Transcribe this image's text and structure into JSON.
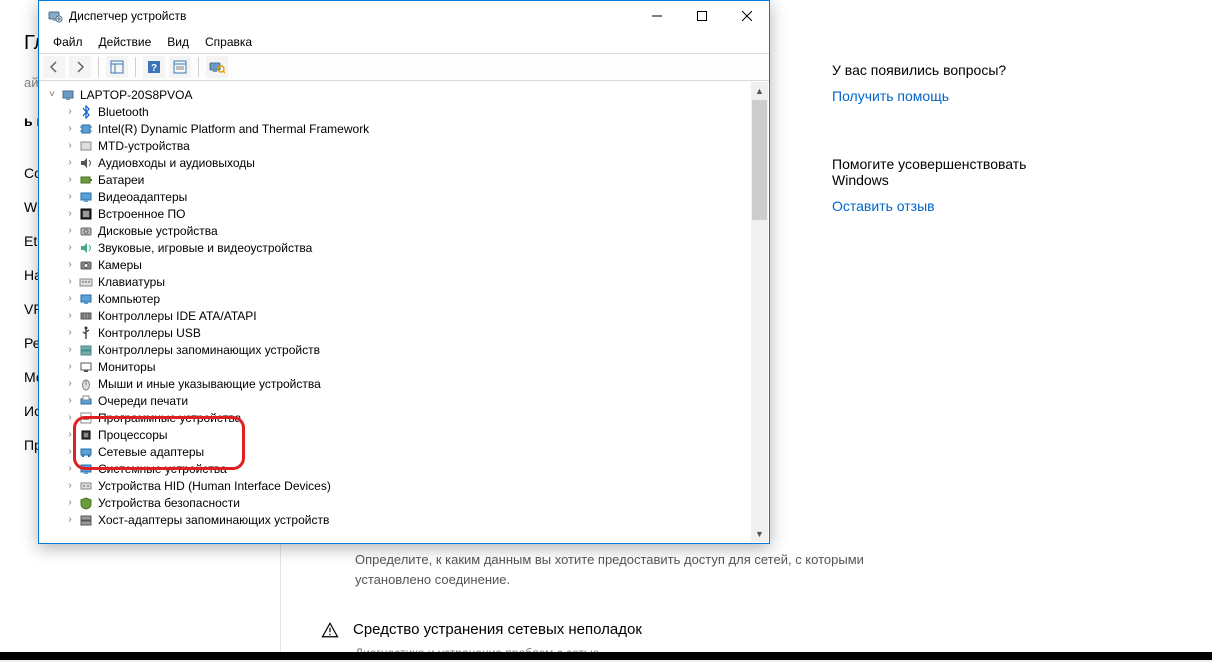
{
  "background": {
    "leftPanel": {
      "header": "Глав",
      "search": "айти ...",
      "sectionPrefix": "ь и И",
      "items": [
        "Сост",
        "Wi-F",
        "Ether",
        "Набо",
        "VPN",
        "Режи",
        "Моб",
        "Исп",
        "Про"
      ]
    },
    "aside": {
      "question": "У вас появились вопросы?",
      "helpLink": "Получить помощь",
      "improve": "Помогите усовершенствовать Windows",
      "feedbackLink": "Оставить отзыв"
    },
    "firewall": {
      "desc": "Определите, к каким данным вы хотите предоставить доступ для сетей, с которыми установлено соединение."
    },
    "troubleshoot": {
      "title": "Средство устранения сетевых неполадок",
      "sub": "Диагностика и устранение проблем с сетью."
    }
  },
  "dm": {
    "title": "Диспетчер устройств",
    "menus": [
      "Файл",
      "Действие",
      "Вид",
      "Справка"
    ],
    "root": "LAPTOP-20S8PVOA",
    "items": [
      {
        "icon": "bluetooth",
        "label": "Bluetooth"
      },
      {
        "icon": "chip",
        "label": "Intel(R) Dynamic Platform and Thermal Framework"
      },
      {
        "icon": "mtd",
        "label": "MTD-устройства"
      },
      {
        "icon": "audio",
        "label": "Аудиовходы и аудиовыходы"
      },
      {
        "icon": "battery",
        "label": "Батареи"
      },
      {
        "icon": "video",
        "label": "Видеоадаптеры"
      },
      {
        "icon": "firmware",
        "label": "Встроенное ПО"
      },
      {
        "icon": "disk",
        "label": "Дисковые устройства"
      },
      {
        "icon": "sound",
        "label": "Звуковые, игровые и видеоустройства"
      },
      {
        "icon": "camera",
        "label": "Камеры"
      },
      {
        "icon": "keyboard",
        "label": "Клавиатуры"
      },
      {
        "icon": "computer",
        "label": "Компьютер"
      },
      {
        "icon": "ide",
        "label": "Контроллеры IDE ATA/ATAPI"
      },
      {
        "icon": "usb",
        "label": "Контроллеры USB"
      },
      {
        "icon": "storage",
        "label": "Контроллеры запоминающих устройств"
      },
      {
        "icon": "monitor",
        "label": "Мониторы"
      },
      {
        "icon": "mouse",
        "label": "Мыши и иные указывающие устройства"
      },
      {
        "icon": "printq",
        "label": "Очереди печати"
      },
      {
        "icon": "software",
        "label": "Программные устройства"
      },
      {
        "icon": "cpu",
        "label": "Процессоры"
      },
      {
        "icon": "network",
        "label": "Сетевые адаптеры"
      },
      {
        "icon": "system",
        "label": "Системные устройства"
      },
      {
        "icon": "hid",
        "label": "Устройства HID (Human Interface Devices)"
      },
      {
        "icon": "security",
        "label": "Устройства безопасности"
      },
      {
        "icon": "hoststorage",
        "label": "Хост-адаптеры запоминающих устройств"
      }
    ]
  }
}
